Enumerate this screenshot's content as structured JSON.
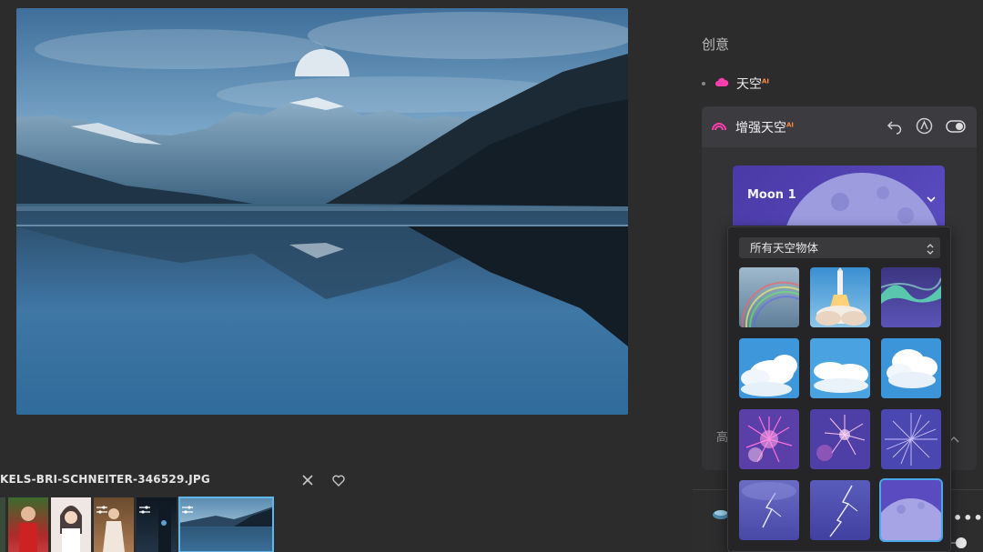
{
  "filmstrip": {
    "file_name": "KELS-BRI-SCHNEITER-346529.JPG",
    "close_icon": "close-icon",
    "favorite_icon": "heart-icon"
  },
  "panel": {
    "section_title": "创意",
    "sky_label": "天空",
    "ai_badge": "AI",
    "card_title": "增强天空",
    "card_ai_badge": "AI",
    "selected_sky": "Moon 1",
    "filter_value": "所有天空物体",
    "advanced_label": "高",
    "more_label": "•••"
  },
  "colors": {
    "accent": "#4aa8e8",
    "sky_icon": "#ff3fae",
    "ai_badge": "#ff8a3d",
    "moon_bg": "#5a4bc0"
  },
  "tiles": [
    {
      "name": "rainbow"
    },
    {
      "name": "rocket"
    },
    {
      "name": "aurora"
    },
    {
      "name": "clouds-1"
    },
    {
      "name": "clouds-2"
    },
    {
      "name": "clouds-3"
    },
    {
      "name": "fireworks-1"
    },
    {
      "name": "fireworks-2"
    },
    {
      "name": "fireworks-3"
    },
    {
      "name": "lightning-1"
    },
    {
      "name": "lightning-2"
    },
    {
      "name": "moon"
    }
  ]
}
